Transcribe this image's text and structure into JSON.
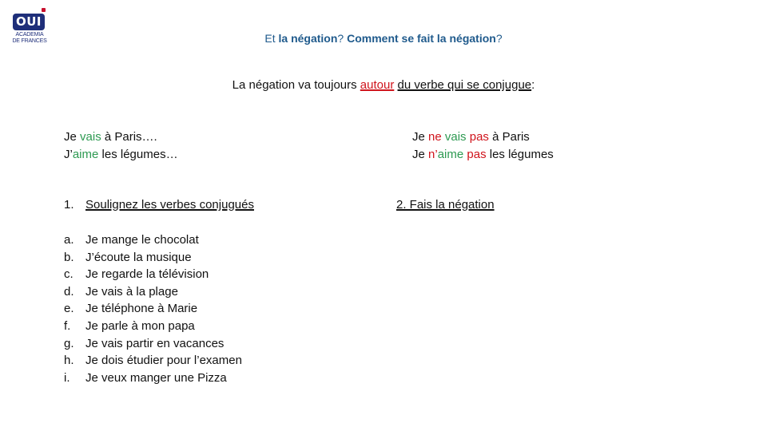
{
  "logo": {
    "badge_text": "OUI",
    "line1": "ACADEMIA",
    "line2": "DE FRANCES"
  },
  "title": {
    "part1": "Et ",
    "part2": "la négation",
    "part3": "? ",
    "part4": "Comment se fait la négation",
    "part5": "?"
  },
  "rule": {
    "prefix": "La négation va toujours ",
    "highlight": "autour",
    "space": " ",
    "underlined": "du verbe qui se conjugue",
    "suffix": ":"
  },
  "examples_affirmative": [
    {
      "before": "Je ",
      "verb": "vais",
      "after": " à Paris…."
    },
    {
      "before": "J’",
      "verb": "aime",
      "after": " les légumes…"
    }
  ],
  "examples_negative": [
    {
      "before": "Je ",
      "neg1": "ne",
      "sp1": " ",
      "verb": "vais",
      "sp2": " ",
      "neg2": "pas",
      "after": " à Paris"
    },
    {
      "before": "Je ",
      "neg1": "n’",
      "sp1": "",
      "verb": "aime",
      "sp2": " ",
      "neg2": "pas",
      "after": " les légumes"
    }
  ],
  "task1": {
    "number": "1.",
    "label": "Soulignez les verbes conjugués"
  },
  "task2": {
    "label": "2. Fais la négation"
  },
  "sentences": [
    {
      "letter": "a.",
      "text": "Je mange le chocolat"
    },
    {
      "letter": "b.",
      "text": "J’écoute la musique"
    },
    {
      "letter": "c.",
      "text": "Je regarde la télévision"
    },
    {
      "letter": "d.",
      "text": "Je vais à la plage"
    },
    {
      "letter": "e.",
      "text": "Je téléphone à Marie"
    },
    {
      "letter": "f.",
      "text": "Je parle à mon papa"
    },
    {
      "letter": "g.",
      "text": "Je vais partir en vacances"
    },
    {
      "letter": "h.",
      "text": "Je dois étudier pour l’examen"
    },
    {
      "letter": "i.",
      "text": "Je veux manger une Pizza"
    }
  ],
  "colors": {
    "title_blue": "#1f5a8c",
    "verb_green": "#2e9a52",
    "negation_red": "#d0141c",
    "logo_navy": "#1f2f7a"
  }
}
